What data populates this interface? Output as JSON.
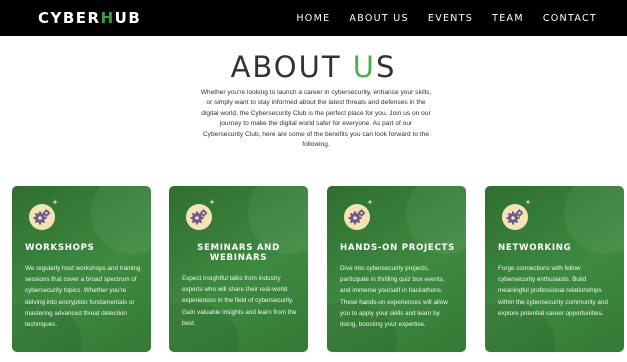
{
  "header": {
    "logo_part1": "CYBER",
    "logo_accent": "H",
    "logo_part2": "UB",
    "nav": [
      {
        "label": "HOME"
      },
      {
        "label": "ABOUT US"
      },
      {
        "label": "EVENTS"
      },
      {
        "label": "TEAM"
      },
      {
        "label": "CONTACT"
      }
    ]
  },
  "about": {
    "title_part1": "ABOUT ",
    "title_accent": "U",
    "title_part2": "S",
    "intro": "Whether you're looking to launch a career in cybersecurity, enhance your skills, or simply want to stay informed about the latest threats and defenses in the digital world, the Cybersecurity Club is the perfect place for you. Join us on our journey to make the digital world safer for everyone. As part of our Cybersecurity Club, here are some of the benefits you can look forward to the following."
  },
  "cards": [
    {
      "icon": "gears-icon",
      "title": "WORKSHOPS",
      "description": "We regularly host workshops and training sessions that cover a broad spectrum of cybersecurity topics. Whether you're delving into encryption fundamentals or mastering advanced threat detection techniques."
    },
    {
      "icon": "gears-icon",
      "title": "SEMINARS AND WEBINARS",
      "description": "Expect insightful talks from industry experts who will share their real-world experiences in the field of cybersecurity. Gain valuable insights and learn from the best."
    },
    {
      "icon": "gears-icon",
      "title": "HANDS-ON PROJECTS",
      "description": "Dive into cybersecurity projects, participate in thrilling quiz box events, and immerse yourself in hackathons. These hands-on experiences will allow you to apply your skills and learn by doing, boosting your expertise."
    },
    {
      "icon": "gears-icon",
      "title": "NETWORKING",
      "description": "Forge connections with fellow cybersecurity enthusiasts. Build meaningful professional relationships within the cybersecurity community and explore potential career opportunities."
    }
  ],
  "colors": {
    "navbar_bg": "#000000",
    "accent": "#4caf50",
    "card_bg": "#3e8a40",
    "icon_circle": "#f6e3b4",
    "gear": "#6b5b8f"
  }
}
